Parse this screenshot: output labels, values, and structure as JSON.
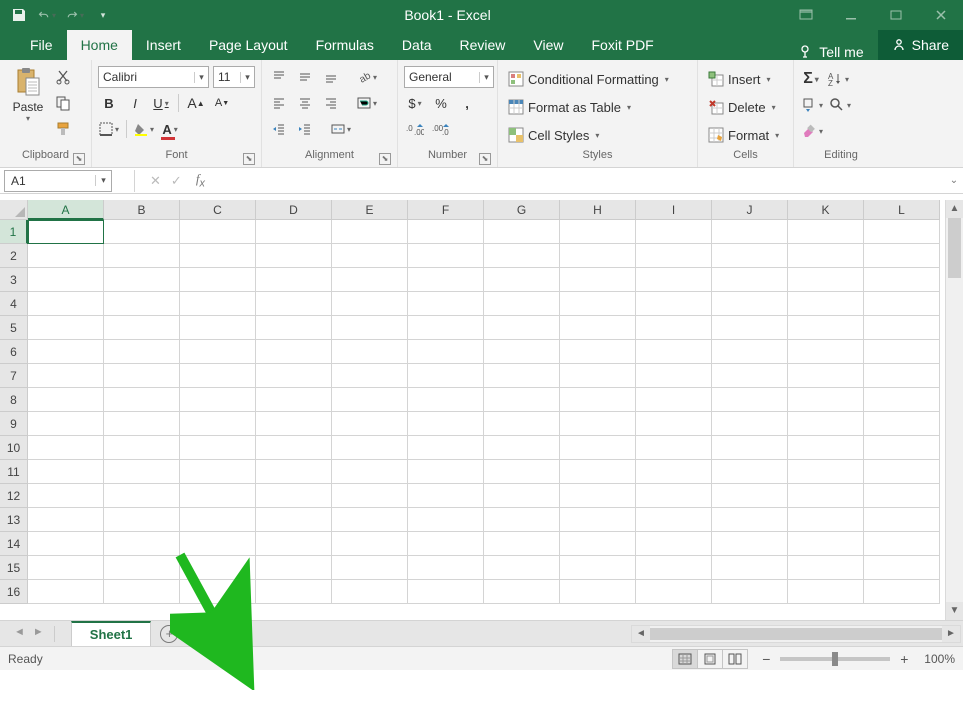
{
  "title": "Book1 - Excel",
  "ribbon_tabs": [
    "File",
    "Home",
    "Insert",
    "Page Layout",
    "Formulas",
    "Data",
    "Review",
    "View",
    "Foxit PDF"
  ],
  "active_tab": "Home",
  "tellme": "Tell me",
  "share": "Share",
  "groups": {
    "clipboard": {
      "label": "Clipboard",
      "paste": "Paste"
    },
    "font": {
      "label": "Font",
      "name": "Calibri",
      "size": "11",
      "bold": "B",
      "italic": "I",
      "underline": "U"
    },
    "alignment": {
      "label": "Alignment"
    },
    "number": {
      "label": "Number",
      "format": "General",
      "currency": "$",
      "percent": "%",
      "comma": ","
    },
    "styles": {
      "label": "Styles",
      "cond": "Conditional Formatting",
      "table": "Format as Table",
      "cell": "Cell Styles"
    },
    "cells": {
      "label": "Cells",
      "insert": "Insert",
      "delete": "Delete",
      "format": "Format"
    },
    "editing": {
      "label": "Editing"
    }
  },
  "namebox": "A1",
  "columns": [
    "A",
    "B",
    "C",
    "D",
    "E",
    "F",
    "G",
    "H",
    "I",
    "J",
    "K",
    "L"
  ],
  "rows": [
    "1",
    "2",
    "3",
    "4",
    "5",
    "6",
    "7",
    "8",
    "9",
    "10",
    "11",
    "12",
    "13",
    "14",
    "15",
    "16"
  ],
  "active_cell": {
    "row": 0,
    "col": 0
  },
  "sheet_tab": "Sheet1",
  "status": "Ready",
  "zoom": "100%"
}
